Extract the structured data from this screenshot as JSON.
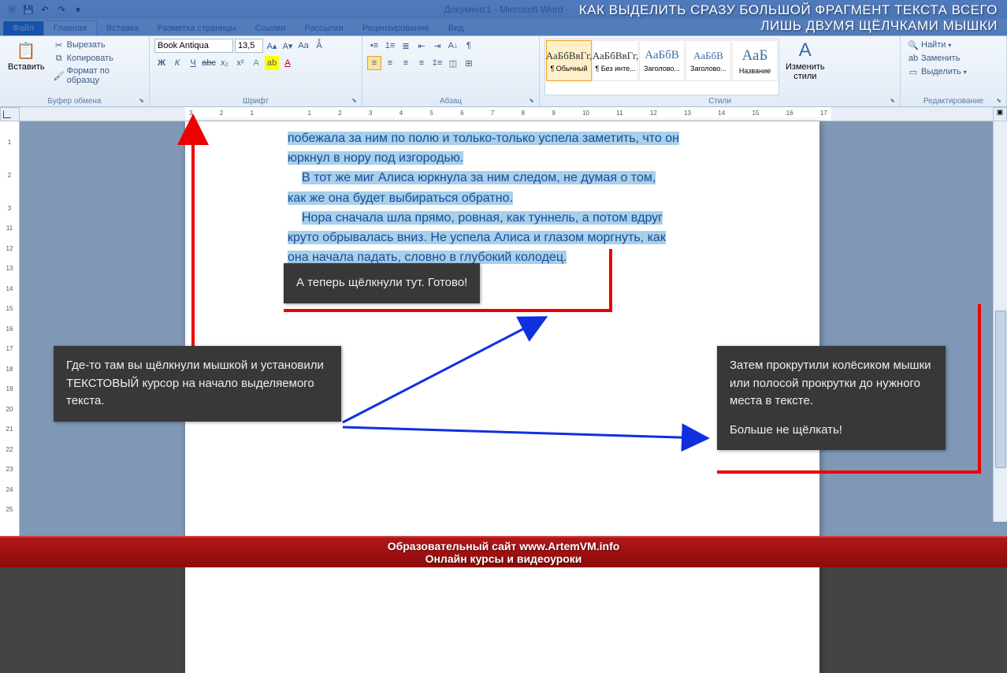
{
  "title": "Документ1 - Microsoft Word",
  "banner": {
    "line1": "КАК ВЫДЕЛИТЬ СРАЗУ БОЛЬШОЙ ФРАГМЕНТ ТЕКСТА ВСЕГО",
    "line2": "ЛИШЬ ДВУМЯ ЩЁЛЧКАМИ МЫШКИ"
  },
  "tabs": {
    "file": "Файл",
    "home": "Главная",
    "insert": "Вставка",
    "layout": "Разметка страницы",
    "refs": "Ссылки",
    "mail": "Рассылки",
    "review": "Рецензирование",
    "view": "Вид"
  },
  "clipboard": {
    "paste": "Вставить",
    "cut": "Вырезать",
    "copy": "Копировать",
    "fmt": "Формат по образцу",
    "label": "Буфер обмена"
  },
  "font": {
    "name": "Book Antiqua",
    "size": "13,5",
    "label": "Шрифт"
  },
  "para": {
    "label": "Абзац"
  },
  "styles": {
    "label": "Стили",
    "change": "Изменить\nстили",
    "items": [
      {
        "prev": "АаБбВвГг,",
        "name": "¶ Обычный"
      },
      {
        "prev": "АаБбВвГг,",
        "name": "¶ Без инте..."
      },
      {
        "prev": "АаБбВ",
        "name": "Заголово..."
      },
      {
        "prev": "АаБбВ",
        "name": "Заголово..."
      },
      {
        "prev": "АаБ",
        "name": "Название"
      }
    ]
  },
  "editing": {
    "find": "Найти",
    "replace": "Заменить",
    "select": "Выделить",
    "label": "Редактирование"
  },
  "doc": {
    "p1a": "побежала за ним по полю и только-только успела заметить, что он",
    "p1b": "юркнул в нору под изгородью.",
    "p2a": "В тот же миг Алиса юркнула за ним следом, не думая о том,",
    "p2b": "как же она будет выбираться обратно.",
    "p3a": "Нора сначала шла прямо, ровная, как туннель, а потом вдруг",
    "p3b": "круто обрывалась вниз. Не успела Алиса и глазом моргнуть, как",
    "p3c": "она начала падать, словно в глубокий колодец."
  },
  "ann": {
    "a1": "А теперь щёлкнули тут. Готово!",
    "a2": "Где-то там вы щёлкнули мышкой и установили ТЕКСТОВЫЙ курсор на начало выделяемого текста.",
    "a3": "Затем прокрутили колёсиком мышки или полосой прокрутки до нужного места в тексте.",
    "a3b": "Больше не щёлкать!"
  },
  "footer": {
    "l1": "Образовательный сайт www.ArtemVM.info",
    "l2": "Онлайн курсы и видеоуроки"
  },
  "ruler_h": [
    "3",
    "2",
    "1",
    "",
    "1",
    "2",
    "3",
    "4",
    "5",
    "6",
    "7",
    "8",
    "9",
    "10",
    "11",
    "12",
    "13",
    "14",
    "15",
    "16",
    "17"
  ],
  "ruler_v": [
    "",
    "1",
    "",
    "2",
    "",
    "3",
    "11",
    "12",
    "13",
    "14",
    "15",
    "16",
    "17",
    "18",
    "19",
    "20",
    "21",
    "22",
    "23",
    "24",
    "25"
  ]
}
